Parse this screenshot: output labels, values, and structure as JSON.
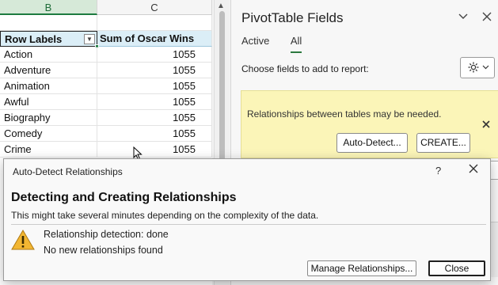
{
  "sheet": {
    "columns": {
      "b": "B",
      "c": "C"
    },
    "header": {
      "row_labels": "Row Labels",
      "sum_label": "Sum of Oscar Wins"
    },
    "rows": [
      {
        "label": "Action",
        "value": "1055"
      },
      {
        "label": "Adventure",
        "value": "1055"
      },
      {
        "label": "Animation",
        "value": "1055"
      },
      {
        "label": "Awful",
        "value": "1055"
      },
      {
        "label": "Biography",
        "value": "1055"
      },
      {
        "label": "Comedy",
        "value": "1055"
      },
      {
        "label": "Crime",
        "value": "1055"
      }
    ]
  },
  "pane": {
    "title": "PivotTable Fields",
    "tabs": [
      "Active",
      "All"
    ],
    "active_tab": "All",
    "choose_label": "Choose fields to add to report:",
    "icons": {
      "settings": "gear-icon",
      "dropdown": "chevron-down-icon",
      "collapse": "chevron-down-icon",
      "close": "close-icon"
    },
    "notice": {
      "text": "Relationships between tables may be needed.",
      "auto_detect": "Auto-Detect...",
      "create": "CREATE..."
    }
  },
  "dialog": {
    "title": "Auto-Detect Relationships",
    "help": "?",
    "heading": "Detecting and Creating Relationships",
    "subtitle": "This might take several minutes depending on the complexity of the data.",
    "status_line1": "Relationship detection: done",
    "status_line2": "No new relationships found",
    "manage_button": "Manage Relationships...",
    "close_button": "Close",
    "icon": "warning-icon"
  },
  "colors": {
    "accent": "#1d7b40",
    "notice_bg": "#fbf5b8",
    "pivot_header": "#dbeef7"
  }
}
